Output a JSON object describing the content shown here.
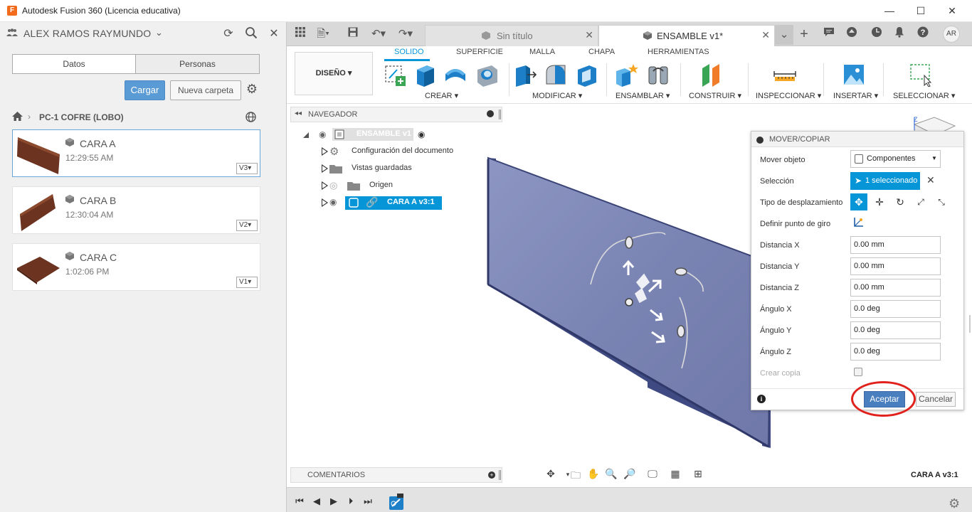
{
  "window": {
    "app_icon_letter": "F",
    "title": "Autodesk Fusion 360 (Licencia educativa)",
    "minimize_glyph": "—",
    "maximize_glyph": "☐",
    "close_glyph": "✕"
  },
  "data_panel": {
    "user": "ALEX RAMOS RAYMUNDO",
    "tabs": [
      "Datos",
      "Personas"
    ],
    "upload_label": "Cargar",
    "new_folder_label": "Nueva carpeta",
    "project": "PC-1 COFRE (LOBO)",
    "files": [
      {
        "name": "CARA A",
        "time": "12:29:55 AM",
        "version": "V3"
      },
      {
        "name": "CARA B",
        "time": "12:30:04 AM",
        "version": "V2"
      },
      {
        "name": "CARA C",
        "time": "1:02:06 PM",
        "version": "V1"
      }
    ]
  },
  "doc_tabs": [
    {
      "label": "Sin título",
      "active": false
    },
    {
      "label": "ENSAMBLE v1*",
      "active": true
    }
  ],
  "user_initials": "AR",
  "ribbon": {
    "workspace": "DISEÑO",
    "tabs": [
      "SOLIDO",
      "SUPERFICIE",
      "MALLA",
      "CHAPA",
      "HERRAMIENTAS"
    ],
    "active_tab": "SOLIDO",
    "groups": [
      "CREAR",
      "MODIFICAR",
      "ENSAMBLAR",
      "CONSTRUIR",
      "INSPECCIONAR",
      "INSERTAR",
      "SELECCIONAR"
    ]
  },
  "browser": {
    "title": "NAVEGADOR",
    "root": "ENSAMBLE v1",
    "items": [
      "Configuración del documento",
      "Vistas guardadas",
      "Origen",
      "CARA A v3:1"
    ]
  },
  "comments_label": "COMENTARIOS",
  "status_component": "CARA A v3:1",
  "dialog": {
    "title": "MOVER/COPIAR",
    "move_object_label": "Mover objeto",
    "move_object_value": "Componentes",
    "selection_label": "Selección",
    "selection_value": "1 seleccionado",
    "move_type_label": "Tipo de desplazamiento",
    "pivot_label": "Definir punto de giro",
    "fields": [
      {
        "label": "Distancia X",
        "value": "0.00 mm"
      },
      {
        "label": "Distancia Y",
        "value": "0.00 mm"
      },
      {
        "label": "Distancia Z",
        "value": "0.00 mm"
      },
      {
        "label": "Ángulo X",
        "value": "0.0 deg"
      },
      {
        "label": "Ángulo Y",
        "value": "0.0 deg"
      },
      {
        "label": "Ángulo Z",
        "value": "0.0 deg"
      }
    ],
    "create_copy_label": "Crear copia",
    "ok_label": "Aceptar",
    "cancel_label": "Cancelar"
  },
  "colors": {
    "accent": "#0696d7",
    "highlight_circle": "#e0211c",
    "part": "#7d87b6"
  }
}
